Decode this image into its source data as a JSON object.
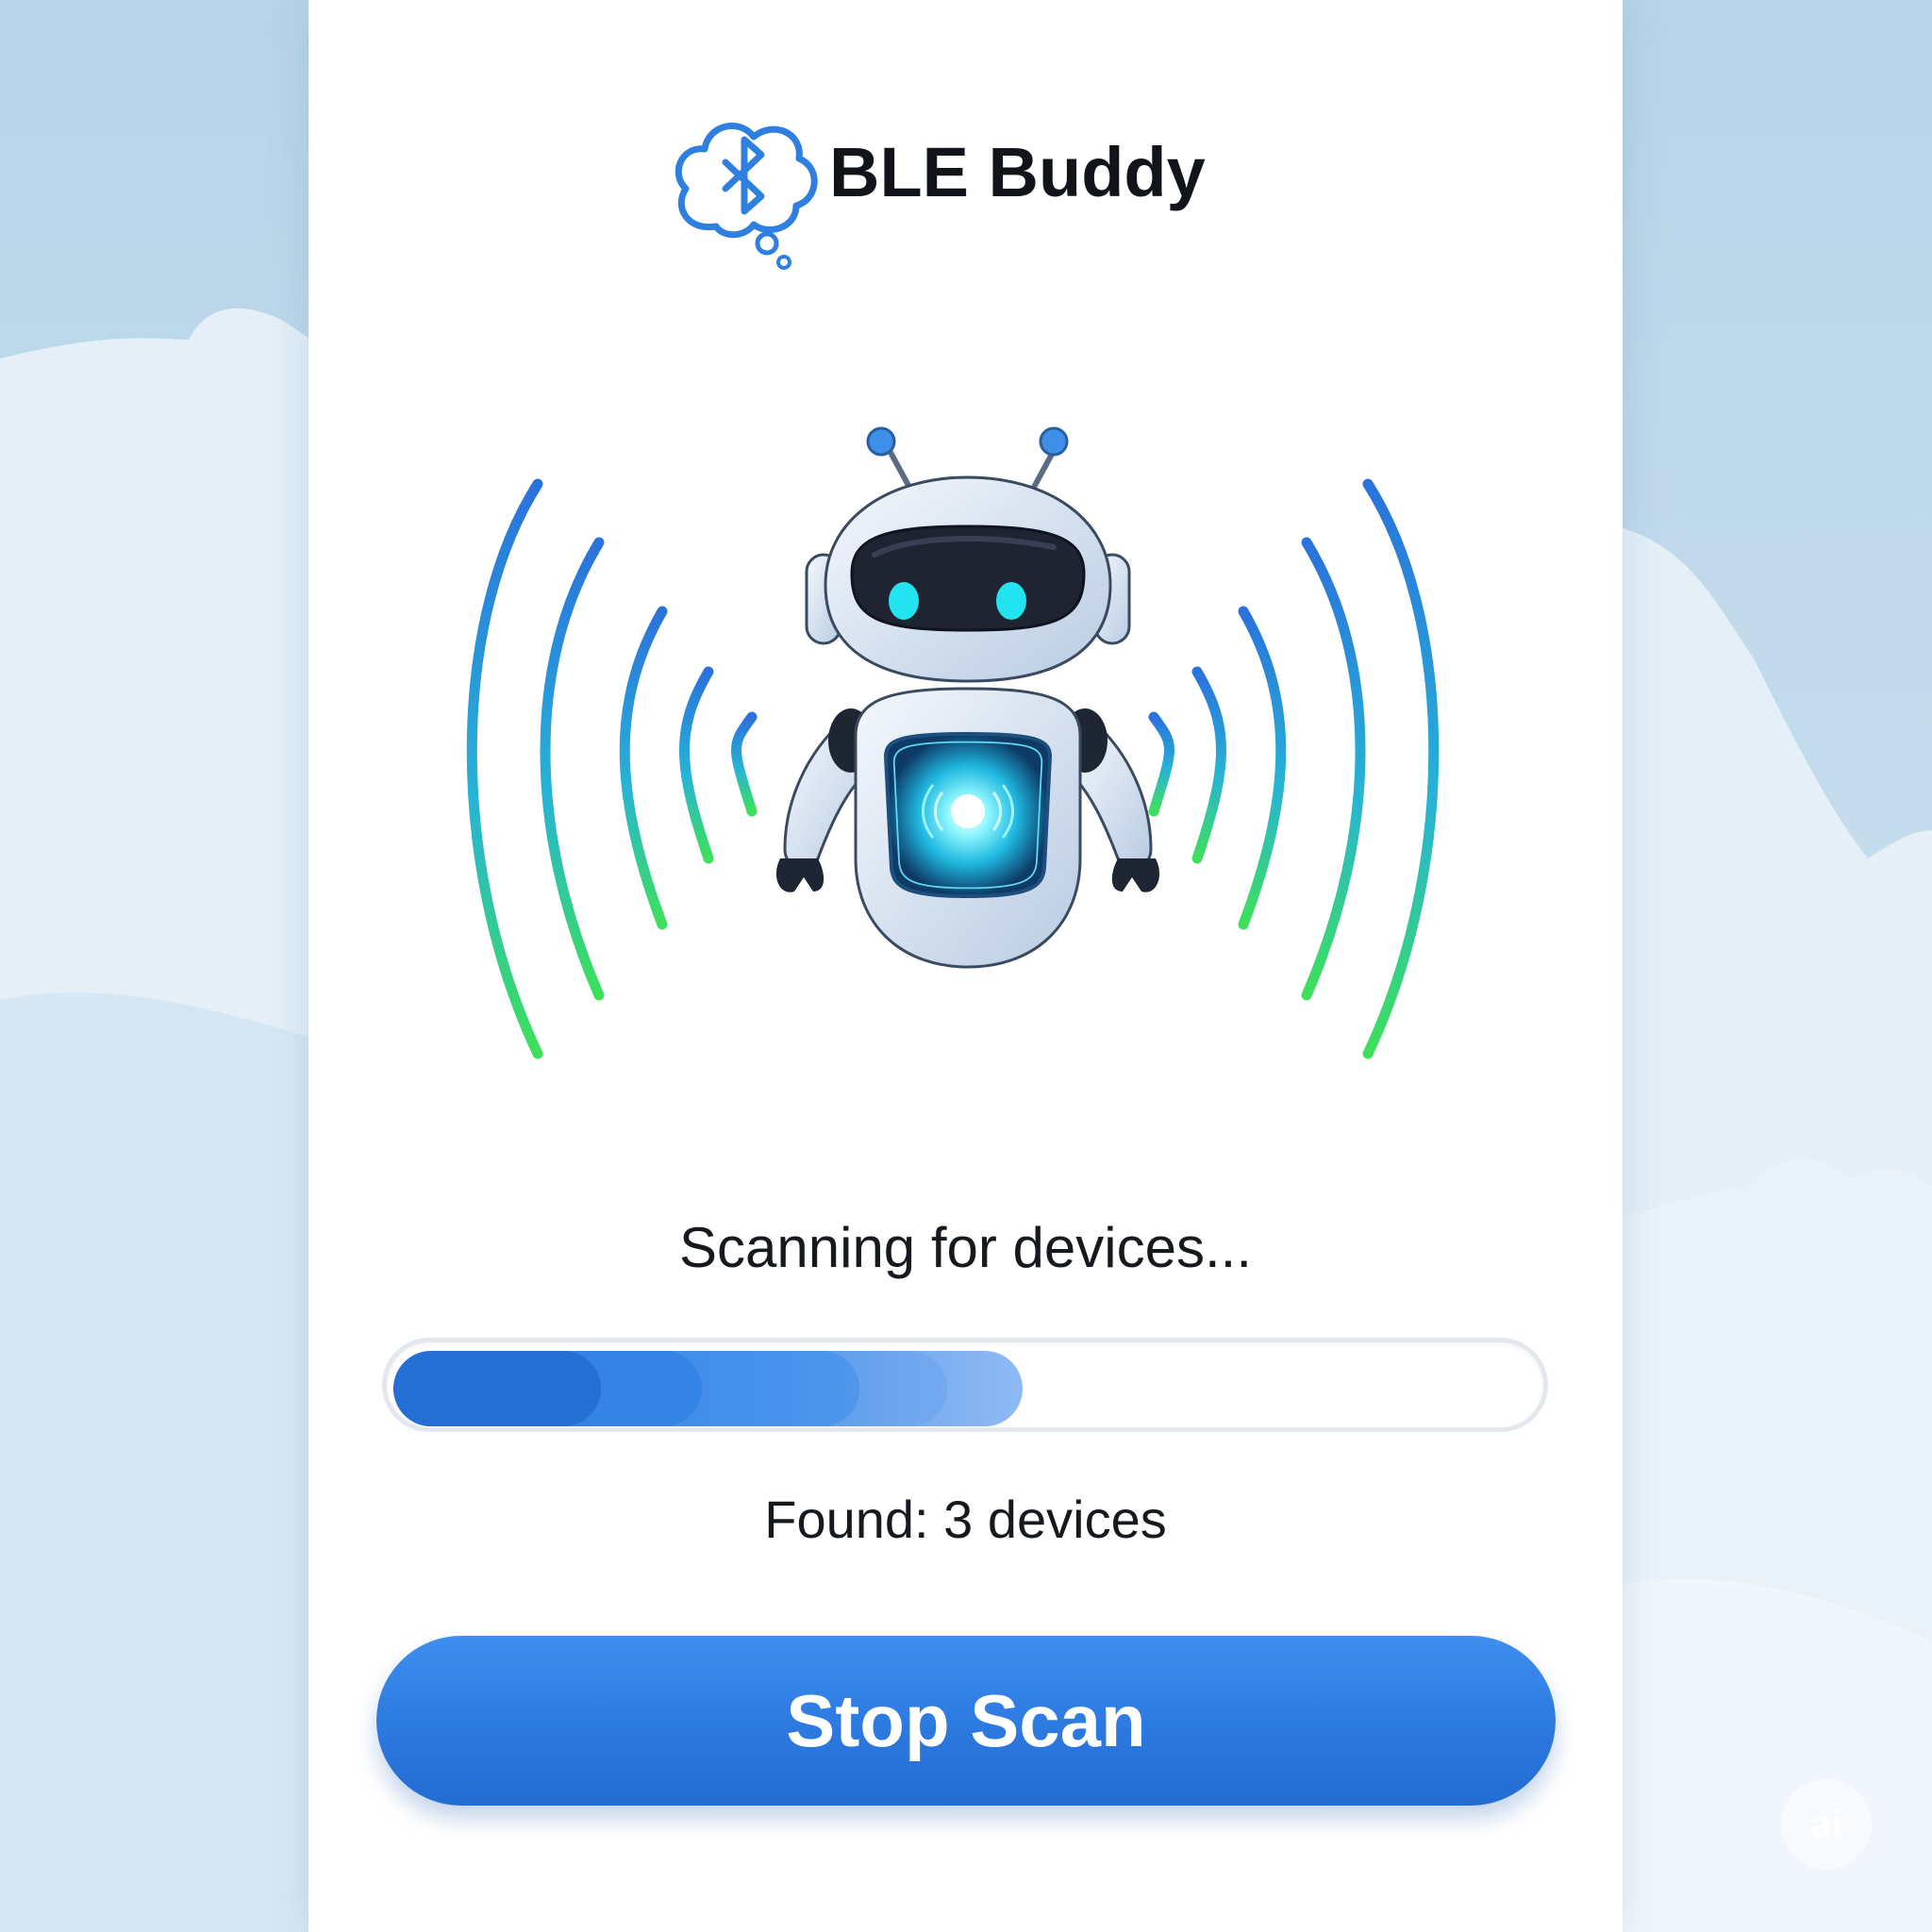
{
  "app": {
    "title": "BLE Buddy",
    "logo_icon": "bluetooth-cloud-icon",
    "mascot_icon": "robot-icon"
  },
  "scan": {
    "status_label": "Scanning for devices...",
    "progress_fraction": 0.55,
    "found_label": "Found: 3 devices",
    "stop_button_label": "Stop Scan"
  },
  "badge": {
    "label": "ai"
  },
  "colors": {
    "accent_blue": "#2c79df",
    "wave_start": "#2a7ae0",
    "wave_end": "#3ee05a",
    "robot_eye": "#22e3f0",
    "background": "#c3dced"
  }
}
